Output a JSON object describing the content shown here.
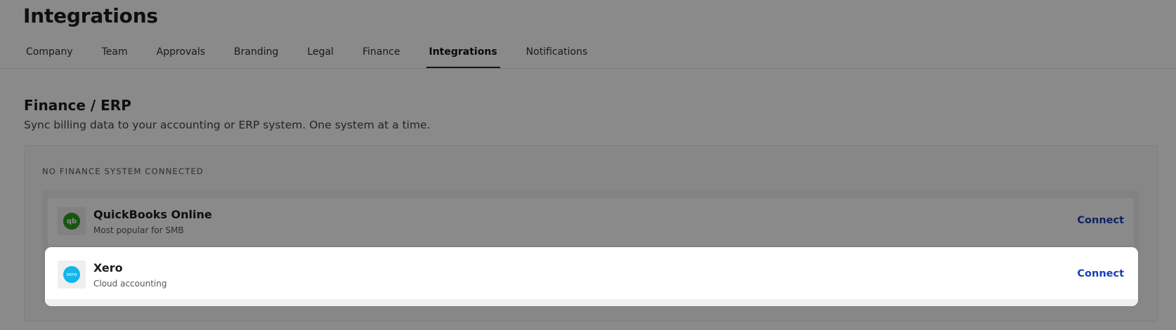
{
  "page": {
    "title": "Integrations"
  },
  "tabs": [
    {
      "label": "Company"
    },
    {
      "label": "Team"
    },
    {
      "label": "Approvals"
    },
    {
      "label": "Branding"
    },
    {
      "label": "Legal"
    },
    {
      "label": "Finance"
    },
    {
      "label": "Integrations",
      "active": true
    },
    {
      "label": "Notifications"
    }
  ],
  "section": {
    "title": "Finance / ERP",
    "description": "Sync billing data to your accounting or ERP system. One system at a time.",
    "status_label": "NO FINANCE SYSTEM CONNECTED"
  },
  "integrations": [
    {
      "name": "QuickBooks Online",
      "subtitle": "Most popular for SMB",
      "action": "Connect",
      "icon": "quickbooks-logo",
      "logo_text": "qb",
      "brand_color": "#2ca01c"
    },
    {
      "name": "Xero",
      "subtitle": "Cloud accounting",
      "action": "Connect",
      "icon": "xero-logo",
      "logo_text": "xero",
      "brand_color": "#13b5ea",
      "highlighted": true
    }
  ],
  "colors": {
    "link": "#1a3fb8",
    "overlay": "rgba(0,0,0,0.46)"
  }
}
